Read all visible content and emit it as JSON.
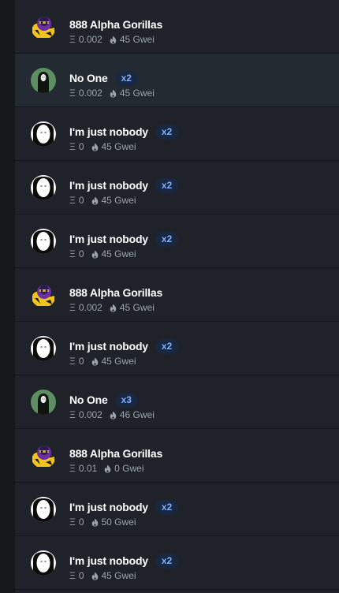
{
  "feed": {
    "items": [
      {
        "name": "888 Alpha Gorillas",
        "avatar": "gorilla-avatar",
        "price": "0.002",
        "gas": "45 Gwei",
        "badge": null,
        "highlight": false
      },
      {
        "name": "No One",
        "avatar": "no-one-avatar",
        "price": "0.002",
        "gas": "45 Gwei",
        "badge": "x2",
        "highlight": true
      },
      {
        "name": "I'm just nobody",
        "avatar": "nobody-avatar",
        "price": "0",
        "gas": "45 Gwei",
        "badge": "x2",
        "highlight": false
      },
      {
        "name": "I'm just nobody",
        "avatar": "nobody-avatar",
        "price": "0",
        "gas": "45 Gwei",
        "badge": "x2",
        "highlight": false
      },
      {
        "name": "I'm just nobody",
        "avatar": "nobody-avatar",
        "price": "0",
        "gas": "45 Gwei",
        "badge": "x2",
        "highlight": false
      },
      {
        "name": "888 Alpha Gorillas",
        "avatar": "gorilla-avatar",
        "price": "0.002",
        "gas": "45 Gwei",
        "badge": null,
        "highlight": false
      },
      {
        "name": "I'm just nobody",
        "avatar": "nobody-avatar",
        "price": "0",
        "gas": "45 Gwei",
        "badge": "x2",
        "highlight": false
      },
      {
        "name": "No One",
        "avatar": "no-one-avatar",
        "price": "0.002",
        "gas": "46 Gwei",
        "badge": "x3",
        "highlight": false
      },
      {
        "name": "888 Alpha Gorillas",
        "avatar": "gorilla-avatar",
        "price": "0.01",
        "gas": "0 Gwei",
        "badge": null,
        "highlight": false
      },
      {
        "name": "I'm just nobody",
        "avatar": "nobody-avatar",
        "price": "0",
        "gas": "50 Gwei",
        "badge": "x2",
        "highlight": false
      },
      {
        "name": "I'm just nobody",
        "avatar": "nobody-avatar",
        "price": "0",
        "gas": "45 Gwei",
        "badge": "x2",
        "highlight": false
      }
    ],
    "eth_symbol": "Ξ",
    "gas_icon": "flame-icon"
  },
  "colors": {
    "background": "#1f2329",
    "highlight_row": "#242a32",
    "badge_bg": "#1a2740",
    "badge_text": "#7fb0ff",
    "meta_text": "#9aa3ad"
  }
}
